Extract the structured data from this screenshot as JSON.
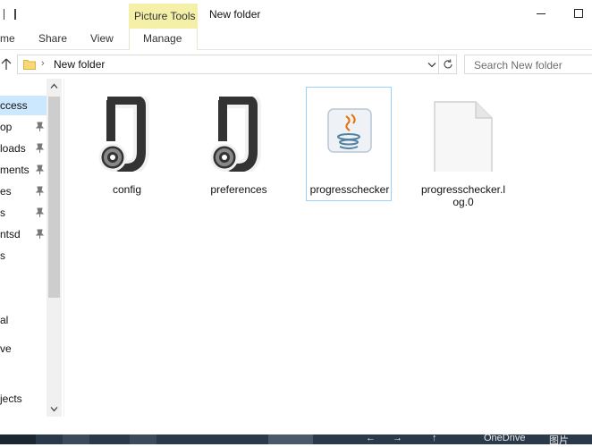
{
  "titlebar": {
    "context_tab": "Picture Tools",
    "window_title": "New folder"
  },
  "ribbon": {
    "tabs": [
      "me",
      "Share",
      "View",
      "Manage"
    ]
  },
  "address": {
    "crumb": "New folder",
    "search_placeholder": "Search New folder"
  },
  "nav": {
    "items": [
      {
        "label": "ccess",
        "selected": true,
        "pinned": false
      },
      {
        "label": "op",
        "pinned": true
      },
      {
        "label": "loads",
        "pinned": true
      },
      {
        "label": "ments",
        "pinned": true
      },
      {
        "label": "es",
        "pinned": true
      },
      {
        "label": "s",
        "pinned": true
      },
      {
        "label": "ntsd",
        "pinned": true
      },
      {
        "label": "s",
        "pinned": false
      },
      {
        "label": "al",
        "pinned": false
      },
      {
        "label": "ve",
        "pinned": false
      },
      {
        "label": "jects",
        "pinned": false
      }
    ]
  },
  "files": [
    {
      "name": "config",
      "icon": "json-file-icon"
    },
    {
      "name": "preferences",
      "icon": "json-file-icon"
    },
    {
      "name": "progresschecker",
      "icon": "java-file-icon",
      "selected": true
    },
    {
      "name": "progresschecker.log.0",
      "icon": "blank-file-icon"
    }
  ],
  "taskbar": {
    "onedrive": "OneDrive",
    "ime": "图片"
  },
  "colors": {
    "selection": "#cce8ff",
    "picture_tools": "#f5f0a8",
    "accent_border": "#99d1ff"
  }
}
